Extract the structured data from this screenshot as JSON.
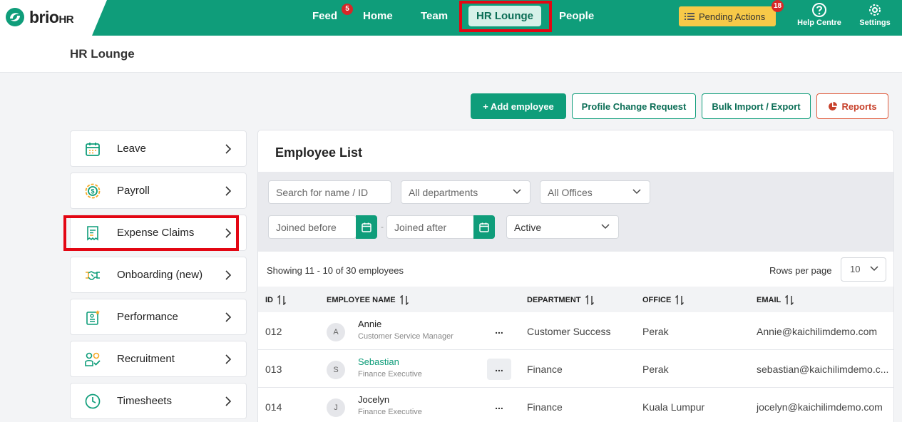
{
  "logo": {
    "brand": "brio",
    "suffix": "HR"
  },
  "nav": {
    "items": [
      {
        "label": "Feed",
        "badge": "5"
      },
      {
        "label": "Home"
      },
      {
        "label": "Team"
      },
      {
        "label": "HR Lounge",
        "active": true
      },
      {
        "label": "People"
      }
    ],
    "pending_label": "Pending Actions",
    "pending_count": "18",
    "help_label": "Help Centre",
    "settings_label": "Settings"
  },
  "page": {
    "title": "HR Lounge"
  },
  "actions": {
    "add_employee": "+ Add employee",
    "profile_change": "Profile Change Request",
    "bulk_import": "Bulk Import / Export",
    "reports": "Reports"
  },
  "sidebar": {
    "items": [
      {
        "label": "Leave",
        "icon": "calendar-icon"
      },
      {
        "label": "Payroll",
        "icon": "payroll-coin-icon"
      },
      {
        "label": "Expense Claims",
        "icon": "receipt-icon",
        "highlighted": true
      },
      {
        "label": "Onboarding (new)",
        "icon": "handshake-icon"
      },
      {
        "label": "Performance",
        "icon": "performance-icon"
      },
      {
        "label": "Recruitment",
        "icon": "recruitment-icon"
      },
      {
        "label": "Timesheets",
        "icon": "clock-icon"
      }
    ]
  },
  "employee_list": {
    "title": "Employee List",
    "filters": {
      "search_placeholder": "Search for name / ID",
      "department": "All departments",
      "office": "All Offices",
      "joined_before_placeholder": "Joined before",
      "joined_after_placeholder": "Joined after",
      "separator": "-",
      "status": "Active"
    },
    "showing": "Showing 11 - 10 of 30 employees",
    "rows_per_page_label": "Rows per page",
    "rows_per_page": "10",
    "columns": [
      "ID",
      "EMPLOYEE NAME",
      "DEPARTMENT",
      "OFFICE",
      "EMAIL"
    ],
    "rows": [
      {
        "id": "012",
        "initial": "A",
        "name": "Annie",
        "role": "Customer Service Manager",
        "more": "...",
        "department": "Customer Success",
        "office": "Perak",
        "email": "Annie@kaichilimdemo.com"
      },
      {
        "id": "013",
        "initial": "S",
        "name": "Sebastian",
        "role": "Finance Executive",
        "more": "...",
        "department": "Finance",
        "office": "Perak",
        "email": "sebastian@kaichilimdemo.c..."
      },
      {
        "id": "014",
        "initial": "J",
        "name": "Jocelyn",
        "role": "Finance Executive",
        "more": "...",
        "department": "Finance",
        "office": "Kuala Lumpur",
        "email": "jocelyn@kaichilimdemo.com"
      }
    ]
  },
  "colors": {
    "brand": "#0f9d7a",
    "highlight": "#e30613",
    "pending": "#f7c948",
    "badge": "#d62828"
  }
}
